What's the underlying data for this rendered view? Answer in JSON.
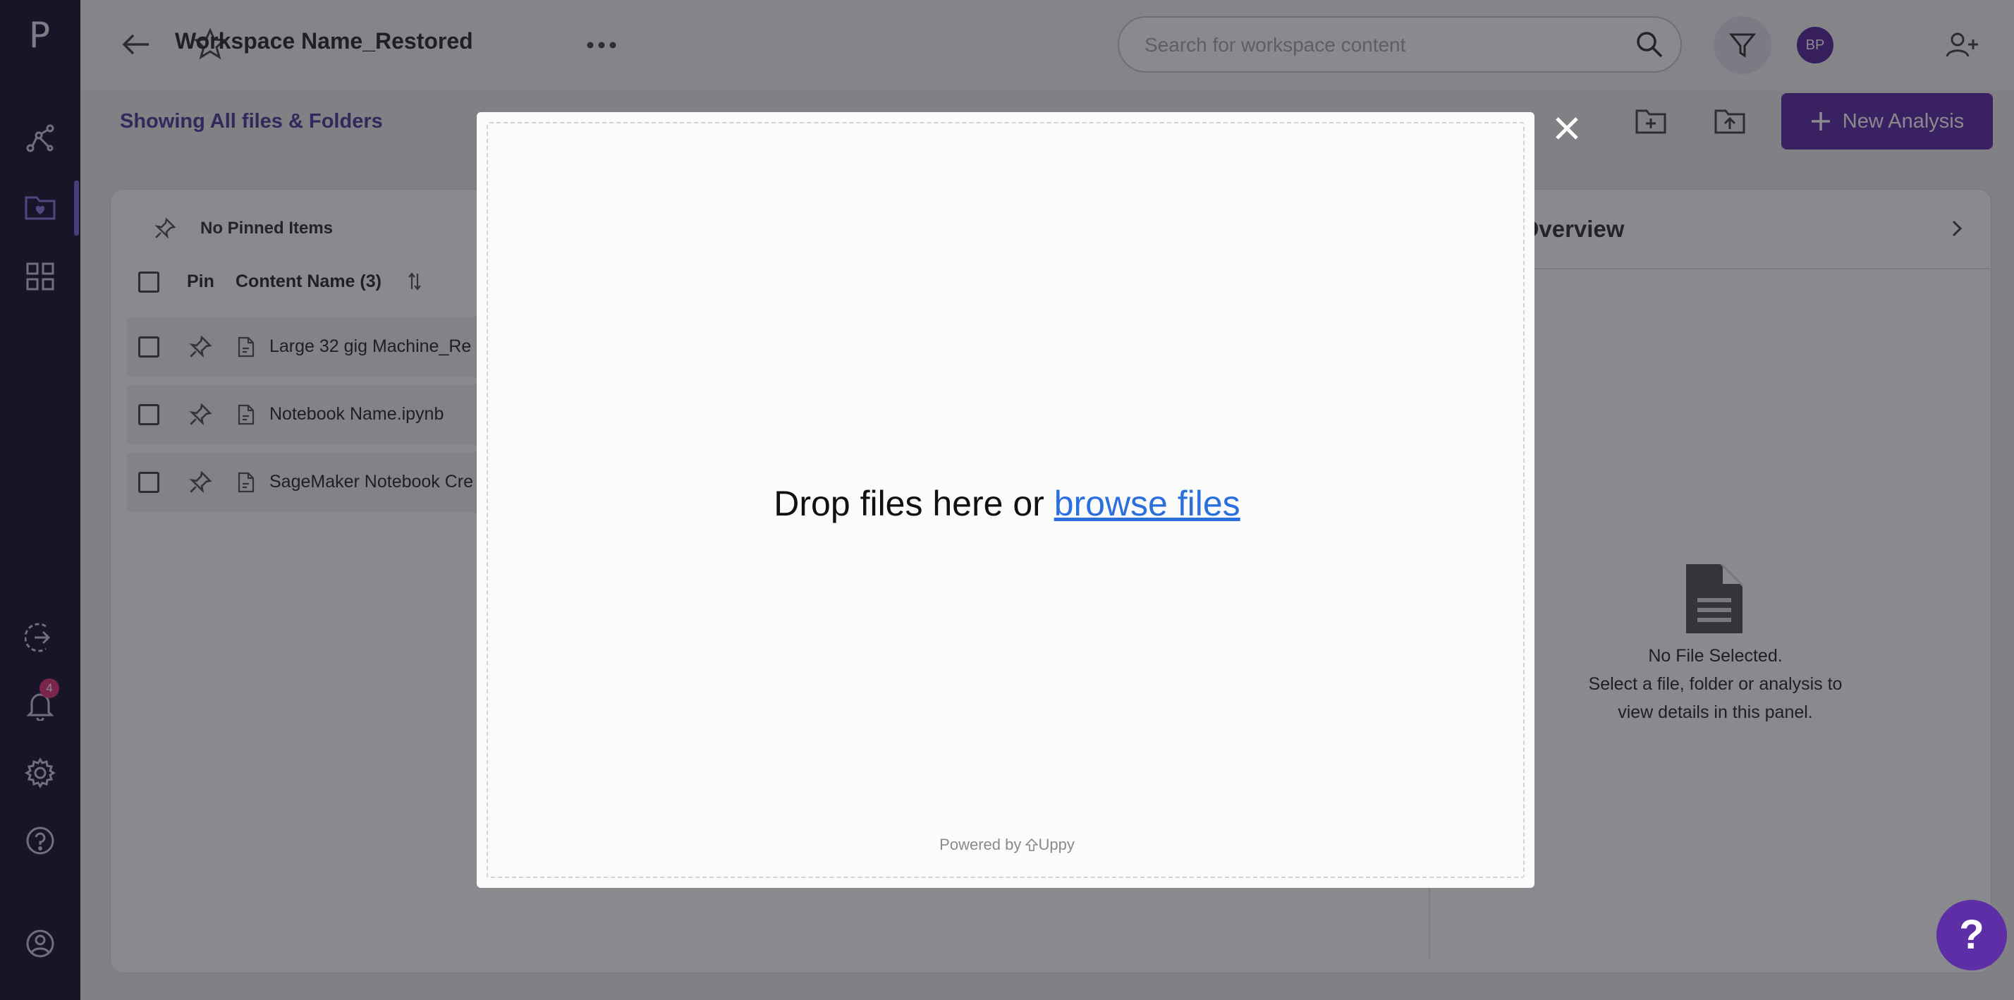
{
  "rail": {
    "logo": "P",
    "notification_count": "4",
    "icons": [
      "analytics-icon",
      "workspace-folder-icon",
      "apps-grid-icon",
      "sign-in-icon",
      "bell-icon",
      "gear-icon",
      "help-icon",
      "user-account-icon"
    ],
    "active_item": "workspace-folder-icon"
  },
  "header": {
    "workspace_title": "Workspace Name_Restored",
    "search_placeholder": "Search for workspace content",
    "avatar_initials": "BP"
  },
  "toolbar": {
    "showing_label": "Showing All files & Folders",
    "new_analysis_label": "New Analysis"
  },
  "file_list": {
    "pinned_label": "No Pinned Items",
    "col_pin": "Pin",
    "col_name": "Content Name (3)",
    "rows": [
      {
        "name": "Large 32 gig Machine_Re"
      },
      {
        "name": "Notebook Name.ipynb"
      },
      {
        "name": "SageMaker Notebook Cre"
      }
    ]
  },
  "details": {
    "title": "ls Overview",
    "no_file_title": "No File Selected.",
    "no_file_line1": "Select a file, folder or analysis to",
    "no_file_line2": "view details in this panel."
  },
  "upload_modal": {
    "drop_text": "Drop files here or ",
    "browse_link": "browse files",
    "powered_by": "Powered by",
    "brand": "Uppy"
  },
  "help_fab": "?",
  "colors": {
    "rail_bg": "#1b1730",
    "accent": "#5e2ea6",
    "link": "#2a6fdb",
    "badge": "#e2347a"
  }
}
